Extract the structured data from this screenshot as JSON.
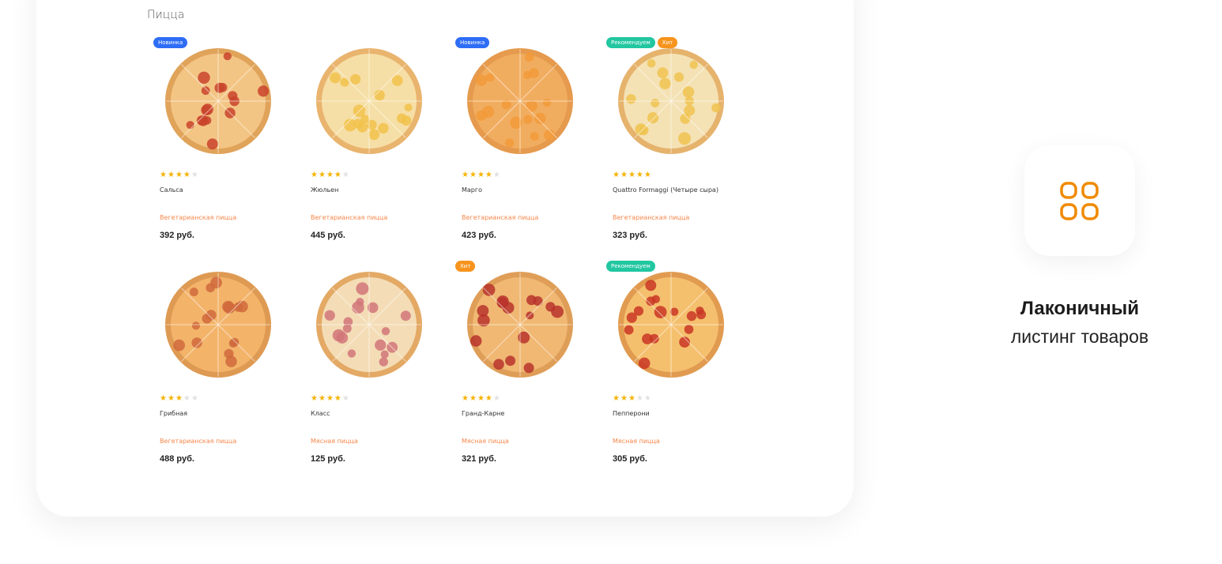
{
  "section": {
    "title": "Пицца"
  },
  "colors": {
    "badge_new": "#2e6df6",
    "badge_recommended": "#22c7a1",
    "badge_hit": "#f7941d",
    "category_text": "#f4874b",
    "star": "#f5b300",
    "accent_icon": "#f08a00"
  },
  "products": [
    {
      "name": "Сальса",
      "category": "Вегетарианская пицца",
      "price": "392 руб.",
      "rating": 4,
      "badges": [
        "Новинка"
      ],
      "badge_types": [
        "new"
      ],
      "image_icon": "pizza-image"
    },
    {
      "name": "Жюльен",
      "category": "Вегетарианская пицца",
      "price": "445 руб.",
      "rating": 4,
      "badges": [],
      "badge_types": [],
      "image_icon": "pizza-image"
    },
    {
      "name": "Марго",
      "category": "Вегетарианская пицца",
      "price": "423 руб.",
      "rating": 4,
      "badges": [
        "Новинка"
      ],
      "badge_types": [
        "new"
      ],
      "image_icon": "pizza-image"
    },
    {
      "name": "Quattro Formaggi (Четыре сыра)",
      "category": "Вегетарианская пицца",
      "price": "323 руб.",
      "rating": 5,
      "badges": [
        "Рекомендуем",
        "Хит"
      ],
      "badge_types": [
        "recommended",
        "hit"
      ],
      "image_icon": "pizza-image"
    },
    {
      "name": "Грибная",
      "category": "Вегетарианская пицца",
      "price": "488 руб.",
      "rating": 3,
      "badges": [],
      "badge_types": [],
      "image_icon": "pizza-image"
    },
    {
      "name": "Класс",
      "category": "Мясная пицца",
      "price": "125 руб.",
      "rating": 4,
      "badges": [],
      "badge_types": [],
      "image_icon": "pizza-image"
    },
    {
      "name": "Гранд-Карне",
      "category": "Мясная пицца",
      "price": "321 руб.",
      "rating": 4,
      "badges": [
        "Хит"
      ],
      "badge_types": [
        "hit"
      ],
      "image_icon": "pizza-image"
    },
    {
      "name": "Пепперони",
      "category": "Мясная пицца",
      "price": "305 руб.",
      "rating": 3,
      "badges": [
        "Рекомендуем"
      ],
      "badge_types": [
        "recommended"
      ],
      "image_icon": "pizza-image"
    }
  ],
  "feature": {
    "icon": "grid-icon",
    "title": "Лаконичный",
    "subtitle": "листинг товаров"
  }
}
